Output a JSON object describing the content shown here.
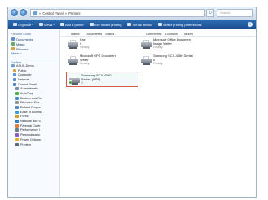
{
  "address": {
    "crumbs": [
      "Control Panel",
      "Printers"
    ],
    "search_placeholder": "Search"
  },
  "toolbar": {
    "items": [
      "Organize",
      "Views",
      "Add a printer",
      "See what's printing",
      "Set as default",
      "Select printing preferences"
    ]
  },
  "nav_pane": {
    "favorites_heading": "Favorite Links",
    "favorites": [
      "Documents",
      "Music",
      "Pictures"
    ],
    "more_label": "More »",
    "folders_label": "Folders",
    "tree": [
      "ASUS-Demo",
      "Public",
      "Computer",
      "Network",
      "Control Panel",
      "Administrativ",
      "AutoPlay",
      "Backup and Re",
      "BitLocker Driv",
      "Default Progra",
      "Ease of Access",
      "Fonts",
      "Network and S",
      "Parental Contr",
      "Performance I",
      "Personalizatio",
      "Power Options",
      "Printers"
    ]
  },
  "columns": [
    "Name",
    "Documents",
    "Status",
    "Comments",
    "Location",
    "Model"
  ],
  "printers": [
    {
      "name": "Fax",
      "line2": "0",
      "status": "Ready"
    },
    {
      "name": "Microsoft Office Document",
      "line2": "Image Writer",
      "status": "Ready"
    },
    {
      "name": "Microsoft XPS Document",
      "line2": "Writer",
      "status": "Ready"
    },
    {
      "name": "Samsung SCX-4080 Series",
      "line2": "0",
      "status": "Ready"
    },
    {
      "name": "Samsung SCX-4080",
      "line2": "Series (USB)",
      "status": "0"
    }
  ],
  "colors": {
    "toolbar": "#1b4f8f",
    "selection_border": "#d9534f",
    "ready_check": "#3aa53a"
  }
}
